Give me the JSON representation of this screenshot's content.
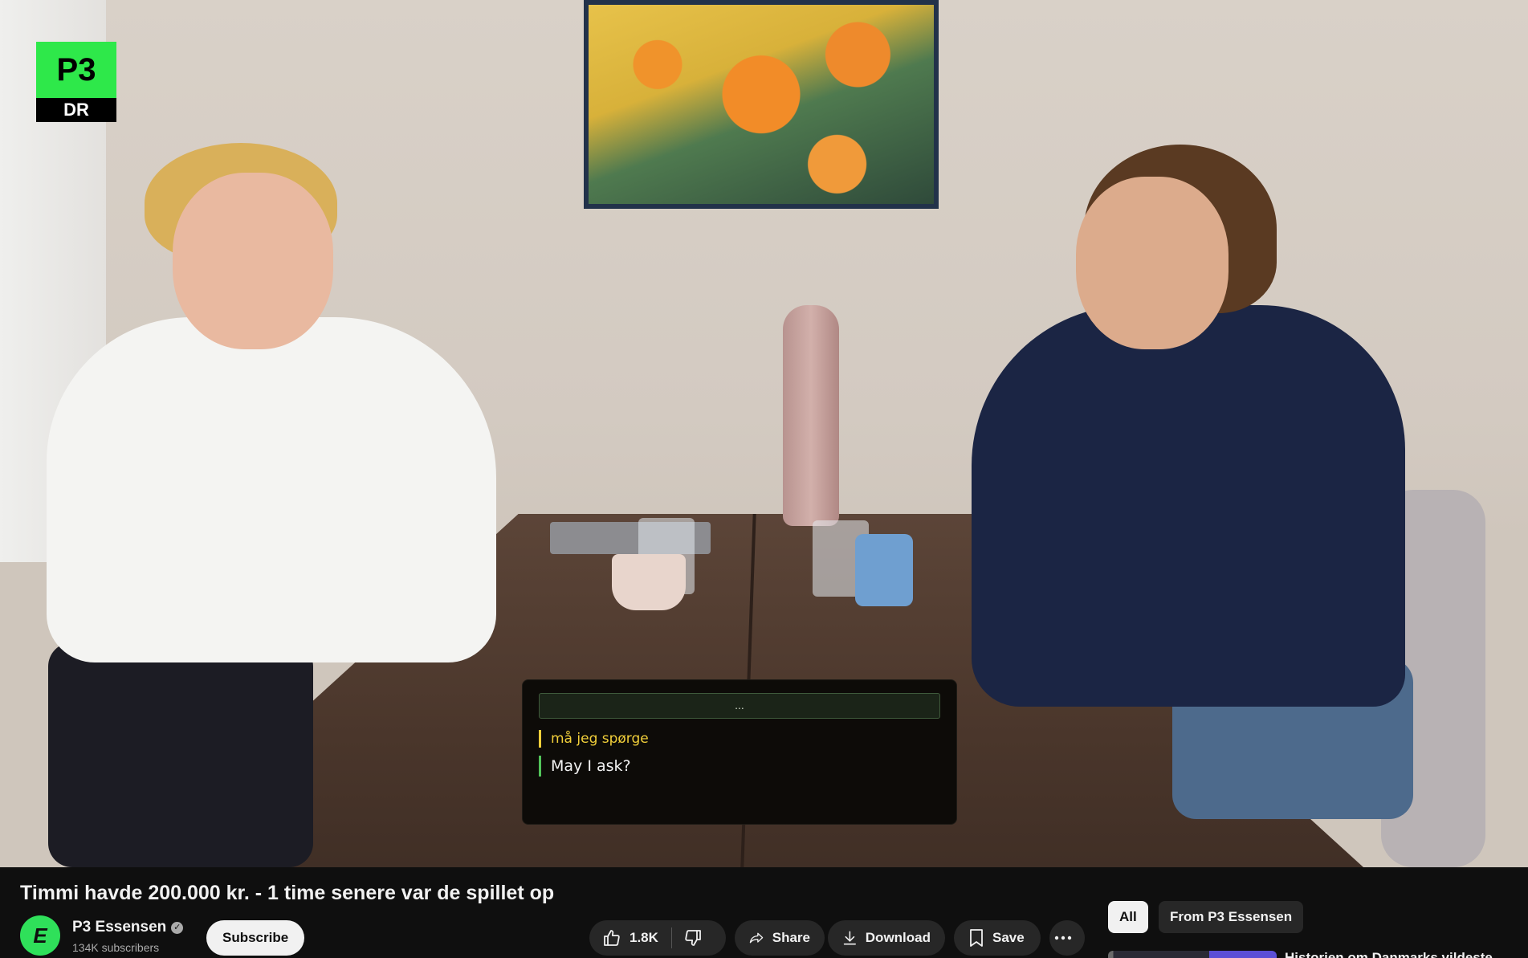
{
  "video": {
    "logo_top": "P3",
    "logo_bottom": "DR",
    "subtitle_panel": {
      "bar_text": "...",
      "source_line": "må jeg spørge",
      "translation_line": "May I ask?"
    }
  },
  "video_title": "Timmi havde 200.000 kr. - 1 time senere var de spillet op",
  "channel": {
    "avatar_text": "E",
    "name": "P3 Essensen",
    "verified_glyph": "✓",
    "subscribers": "134K subscribers",
    "subscribe_label": "Subscribe"
  },
  "actions": {
    "like_count": "1.8K",
    "share_label": "Share",
    "download_label": "Download",
    "save_label": "Save"
  },
  "chips": {
    "all": "All",
    "from_channel": "From P3 Essensen"
  },
  "recommendation_peek": {
    "title_fragment": "Historien om Danmarks vildeste ..."
  },
  "icons": [
    "like-icon",
    "dislike-icon",
    "share-icon",
    "download-icon",
    "save-icon",
    "more-icon",
    "verified-icon"
  ]
}
